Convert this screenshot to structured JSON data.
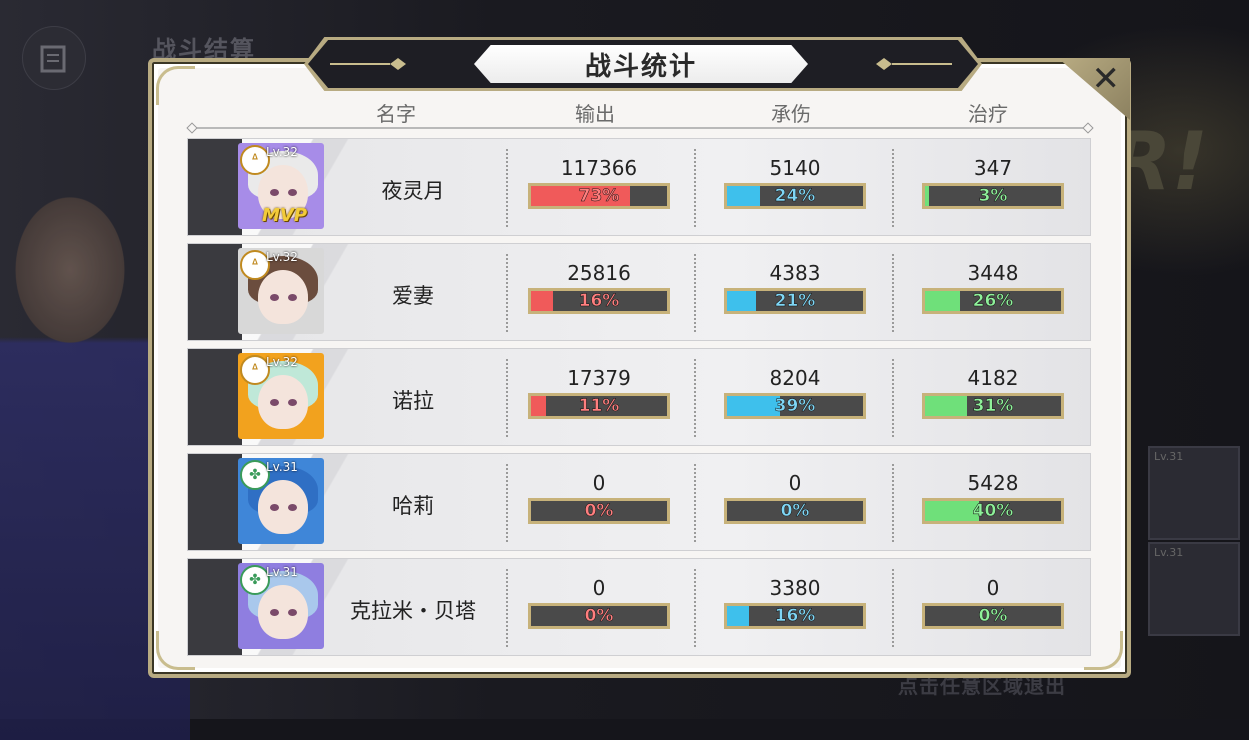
{
  "background": {
    "title": "战斗结算",
    "hint": "点击任意区域退出",
    "big_text": "R!",
    "card_levels": [
      "Lv.31",
      "Lv.31"
    ]
  },
  "panel": {
    "title": "战斗统计",
    "close_label": "✕"
  },
  "columns": {
    "name": "名字",
    "output": "输出",
    "damage_taken": "承伤",
    "healing": "治疗"
  },
  "rows": [
    {
      "name": "夜灵月",
      "level": "Lv.32",
      "class_icon": "a-icon",
      "mvp": "MVP",
      "avatar_frame": "#a78ce8",
      "hair": "#eaeaea",
      "output": "117366",
      "output_pct": "73%",
      "output_fill": 0.73,
      "taken": "5140",
      "taken_pct": "24%",
      "taken_fill": 0.24,
      "heal": "347",
      "heal_pct": "3%",
      "heal_fill": 0.03
    },
    {
      "name": "爱妻",
      "level": "Lv.32",
      "class_icon": "a-icon",
      "mvp": "",
      "avatar_frame": "#d8d8d8",
      "hair": "#6b4d3e",
      "output": "25816",
      "output_pct": "16%",
      "output_fill": 0.16,
      "taken": "4383",
      "taken_pct": "21%",
      "taken_fill": 0.21,
      "heal": "3448",
      "heal_pct": "26%",
      "heal_fill": 0.26
    },
    {
      "name": "诺拉",
      "level": "Lv.32",
      "class_icon": "a-icon",
      "mvp": "",
      "avatar_frame": "#f2a21e",
      "hair": "#bfe8d8",
      "output": "17379",
      "output_pct": "11%",
      "output_fill": 0.11,
      "taken": "8204",
      "taken_pct": "39%",
      "taken_fill": 0.39,
      "heal": "4182",
      "heal_pct": "31%",
      "heal_fill": 0.31
    },
    {
      "name": "哈莉",
      "level": "Lv.31",
      "class_icon": "clover-icon",
      "mvp": "",
      "avatar_frame": "#3f86d8",
      "hair": "#2f6fc4",
      "output": "0",
      "output_pct": "0%",
      "output_fill": 0,
      "taken": "0",
      "taken_pct": "0%",
      "taken_fill": 0,
      "heal": "5428",
      "heal_pct": "40%",
      "heal_fill": 0.4
    },
    {
      "name": "克拉米・贝塔",
      "level": "Lv.31",
      "class_icon": "clover-icon",
      "mvp": "",
      "avatar_frame": "#8f7ee0",
      "hair": "#a9c8ec",
      "output": "0",
      "output_pct": "0%",
      "output_fill": 0,
      "taken": "3380",
      "taken_pct": "16%",
      "taken_fill": 0.16,
      "heal": "0",
      "heal_pct": "0%",
      "heal_fill": 0
    }
  ]
}
